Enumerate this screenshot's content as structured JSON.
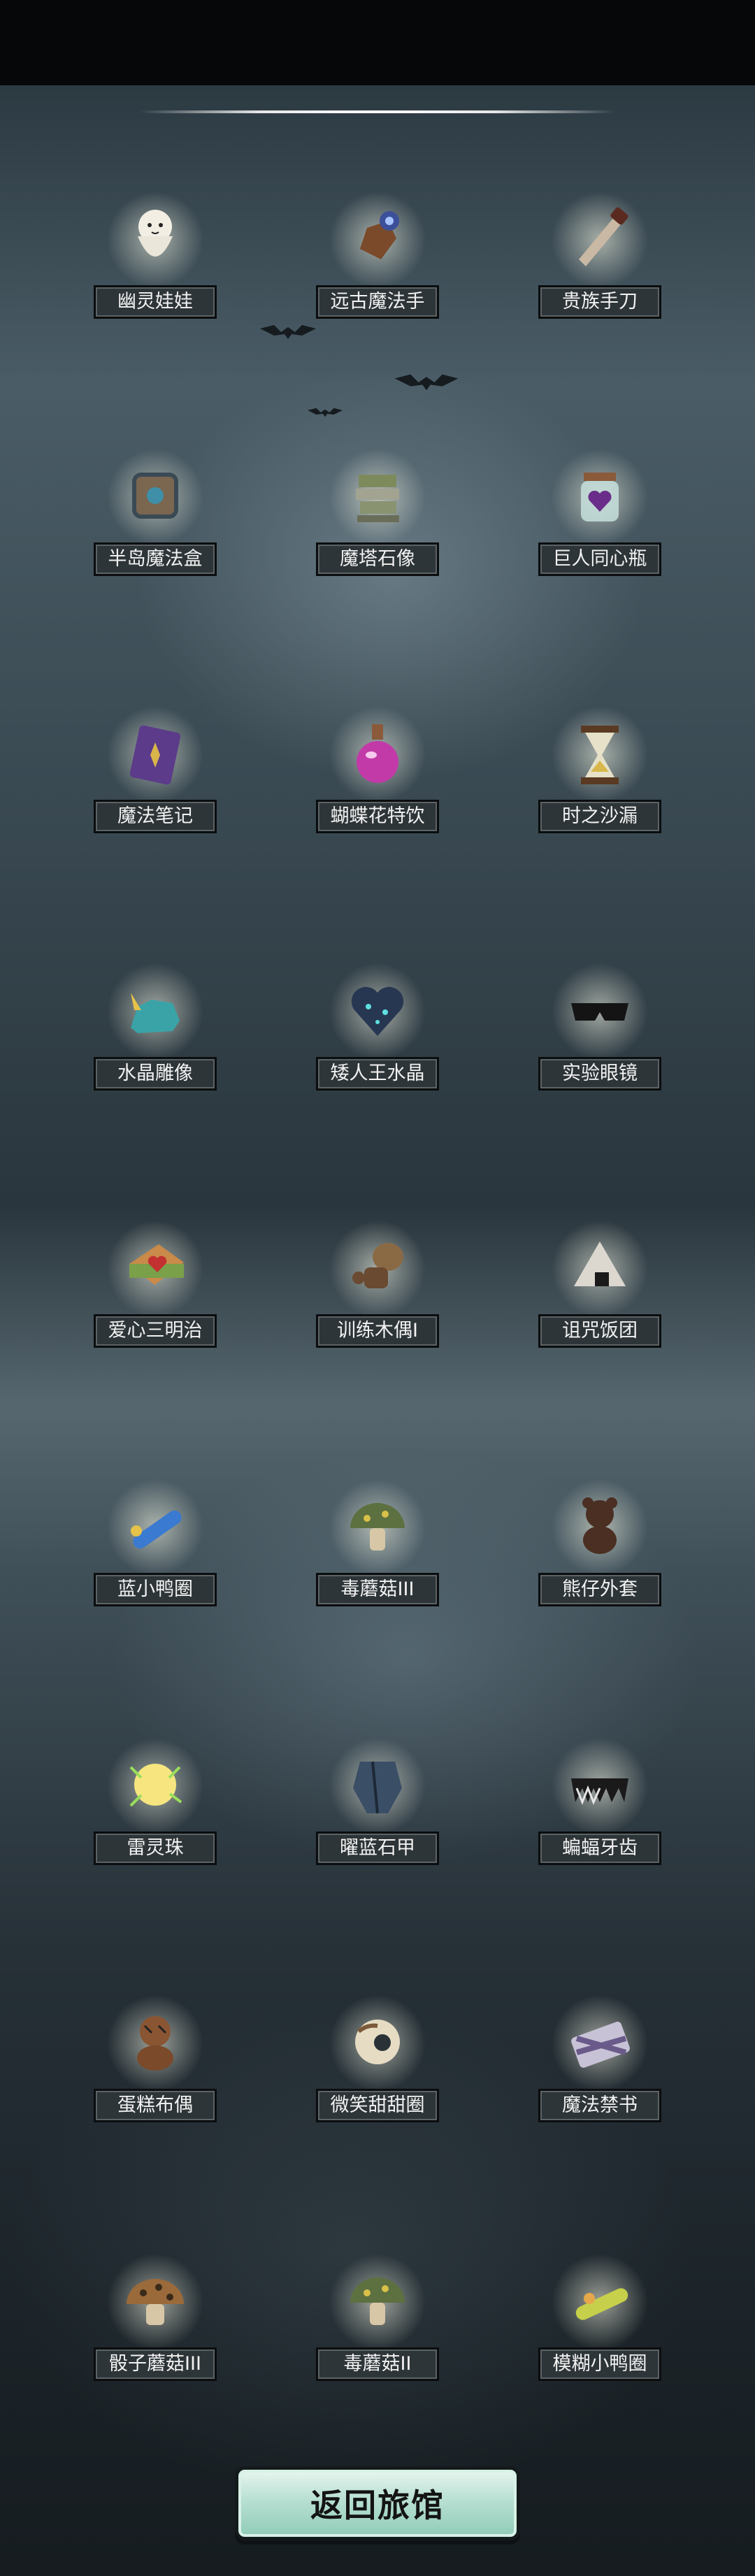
{
  "header": {
    "divider": true
  },
  "items": [
    {
      "name": "幽灵娃娃",
      "icon": "ghost-doll-icon"
    },
    {
      "name": "远古魔法手",
      "icon": "ancient-magic-hand-icon"
    },
    {
      "name": "贵族手刀",
      "icon": "noble-hand-knife-icon"
    },
    {
      "name": "半岛魔法盒",
      "icon": "magic-box-icon"
    },
    {
      "name": "魔塔石像",
      "icon": "tower-statue-icon"
    },
    {
      "name": "巨人同心瓶",
      "icon": "giant-heart-jar-icon"
    },
    {
      "name": "魔法笔记",
      "icon": "magic-notebook-icon"
    },
    {
      "name": "蝴蝶花特饮",
      "icon": "potion-flask-icon"
    },
    {
      "name": "时之沙漏",
      "icon": "hourglass-icon"
    },
    {
      "name": "水晶雕像",
      "icon": "crystal-statue-icon"
    },
    {
      "name": "矮人王水晶",
      "icon": "dwarf-king-crystal-icon"
    },
    {
      "name": "实验眼镜",
      "icon": "sunglasses-icon"
    },
    {
      "name": "爱心三明治",
      "icon": "heart-sandwich-icon"
    },
    {
      "name": "训练木偶I",
      "icon": "training-dummy-icon"
    },
    {
      "name": "诅咒饭团",
      "icon": "cursed-rice-ball-icon"
    },
    {
      "name": "蓝小鸭圈",
      "icon": "blue-duck-ring-icon"
    },
    {
      "name": "毒蘑菇III",
      "icon": "poison-mushroom-icon"
    },
    {
      "name": "熊仔外套",
      "icon": "teddy-bear-icon"
    },
    {
      "name": "雷灵珠",
      "icon": "thunder-orb-icon"
    },
    {
      "name": "曜蓝石甲",
      "icon": "blue-stone-armor-icon"
    },
    {
      "name": "蝙蝠牙齿",
      "icon": "bat-teeth-icon"
    },
    {
      "name": "蛋糕布偶",
      "icon": "cake-doll-icon"
    },
    {
      "name": "微笑甜甜圈",
      "icon": "smile-donut-icon"
    },
    {
      "name": "魔法禁书",
      "icon": "forbidden-book-icon"
    },
    {
      "name": "骰子蘑菇III",
      "icon": "dice-mushroom-icon"
    },
    {
      "name": "毒蘑菇II",
      "icon": "poison-mushroom-icon"
    },
    {
      "name": "模糊小鸭圈",
      "icon": "yellow-duck-ring-icon"
    }
  ],
  "footer": {
    "return_label": "返回旅馆"
  },
  "colors": {
    "label_bg": "#2e3538",
    "button_bg": "#b8e0d2"
  }
}
